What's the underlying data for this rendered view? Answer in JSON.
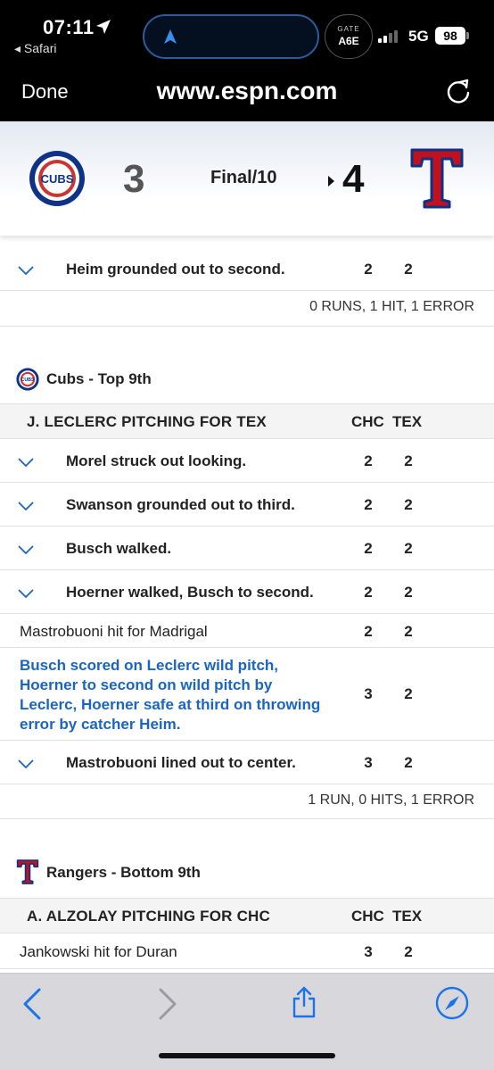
{
  "status_bar": {
    "time": "07:11",
    "back_app": "◂ Safari",
    "gate_label": "GATE",
    "gate_code": "A6E",
    "network": "5G",
    "battery": "98"
  },
  "browser": {
    "done_label": "Done",
    "url": "www.espn.com"
  },
  "score": {
    "away_score": "3",
    "home_score": "4",
    "status": "Final/10",
    "away_team": "CHC",
    "home_team": "TEX",
    "away_color": "#0e3386",
    "home_color": "#c0111f"
  },
  "plays": {
    "prev_last_play": {
      "text": "Heim grounded out to second.",
      "away": "2",
      "home": "2"
    },
    "prev_summary": "0 RUNS, 1 HIT, 1 ERROR",
    "top9": {
      "title": "Cubs - Top 9th",
      "pitcher_header": "J. LECLERC PITCHING FOR TEX",
      "col_away": "CHC",
      "col_home": "TEX",
      "rows": [
        {
          "text": "Morel struck out looking.",
          "away": "2",
          "home": "2"
        },
        {
          "text": "Swanson grounded out to third.",
          "away": "2",
          "home": "2"
        },
        {
          "text": "Busch walked.",
          "away": "2",
          "home": "2"
        },
        {
          "text": "Hoerner walked, Busch to second.",
          "away": "2",
          "home": "2"
        }
      ],
      "sub": {
        "text": "Mastrobuoni hit for Madrigal",
        "away": "2",
        "home": "2"
      },
      "scoring_play": {
        "text": "Busch scored on Leclerc wild pitch, Hoerner to second on wild pitch by Leclerc, Hoerner safe at third on throwing error by catcher Heim.",
        "away": "3",
        "home": "2"
      },
      "last": {
        "text": "Mastrobuoni lined out to center.",
        "away": "3",
        "home": "2"
      },
      "summary": "1 RUN, 0 HITS, 1 ERROR"
    },
    "bottom9": {
      "title": "Rangers - Bottom 9th",
      "pitcher_header": "A. ALZOLAY PITCHING FOR CHC",
      "col_away": "CHC",
      "col_home": "TEX",
      "sub": {
        "text": "Jankowski hit for Duran",
        "away": "3",
        "home": "2"
      }
    }
  },
  "icons": [
    "location-arrow-icon",
    "navigation-icon",
    "signal-icon",
    "battery-icon",
    "reload-icon",
    "chevron-down-icon",
    "back-icon",
    "forward-icon",
    "share-icon",
    "compass-icon"
  ]
}
